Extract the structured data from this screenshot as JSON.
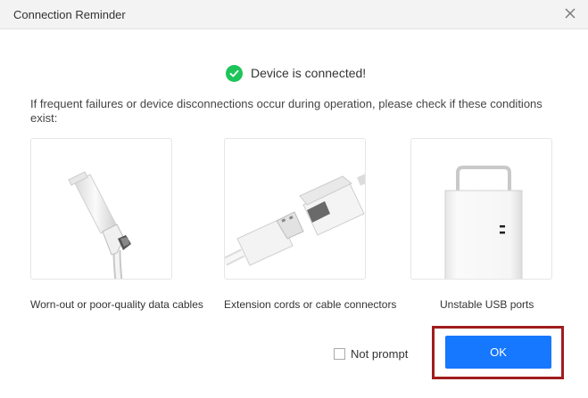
{
  "dialog": {
    "title": "Connection Reminder",
    "status_text": "Device is connected!",
    "hint_text": "If frequent failures or device disconnections occur during operation, please check if these conditions exist:",
    "cards": [
      {
        "caption": "Worn-out or poor-quality data cables",
        "icon": "lightning-cable-icon"
      },
      {
        "caption": "Extension cords or cable connectors",
        "icon": "usb-extension-icon"
      },
      {
        "caption": "Unstable USB ports",
        "icon": "usb-port-icon"
      }
    ],
    "not_prompt_label": "Not prompt",
    "not_prompt_checked": false,
    "ok_label": "OK"
  },
  "colors": {
    "accent": "#1677ff",
    "success": "#1dc45a",
    "highlight_frame": "#a01c1c",
    "titlebar": "#f3f3f3"
  }
}
